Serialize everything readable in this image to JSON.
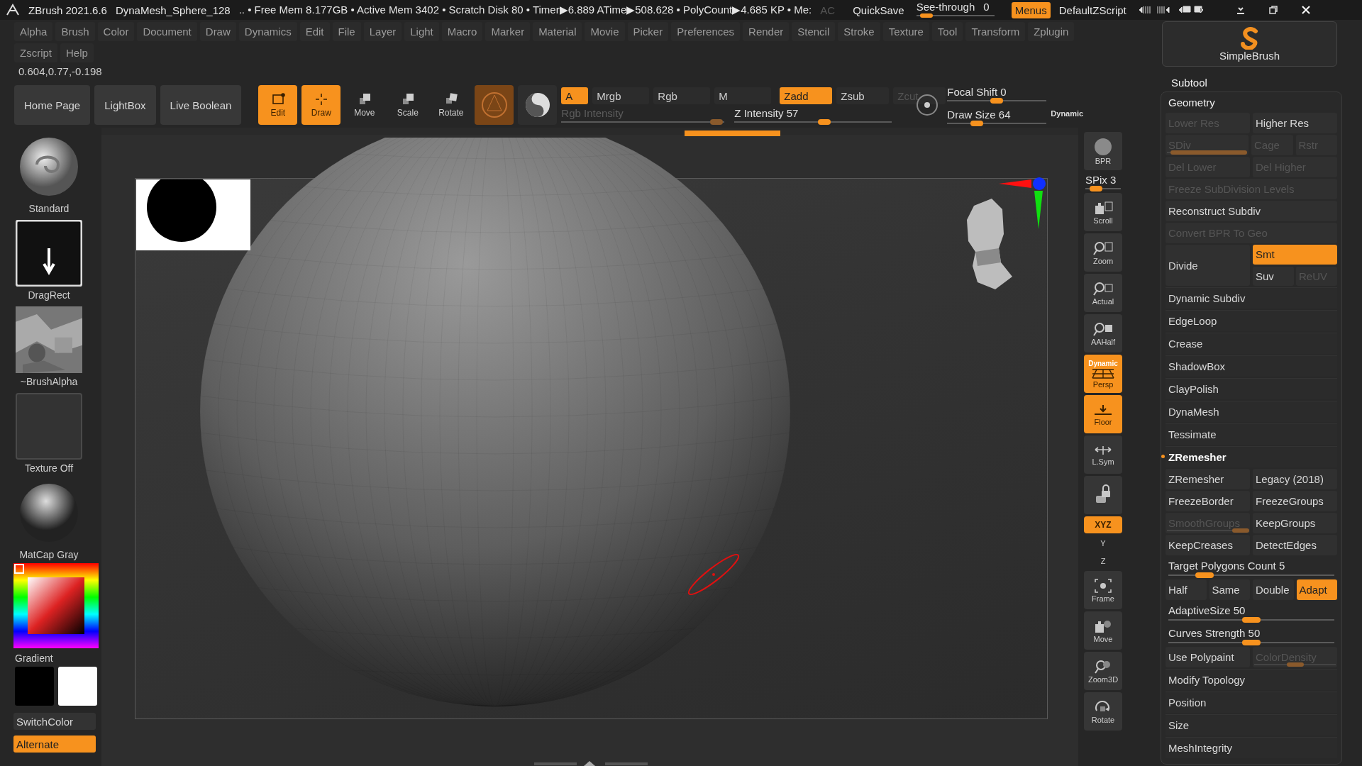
{
  "title_bar": {
    "app": "ZBrush 2021.6.6",
    "document": "DynaMesh_Sphere_128",
    "stats": ".. • Free Mem 8.177GB • Active Mem 3402 • Scratch Disk 80 •  Timer▶6.889 ATime▶508.628 • PolyCount▶4.685 KP  • Me:",
    "stats_dim": "AC",
    "quicksave": "QuickSave",
    "see_through": {
      "label": "See-through",
      "value": "0",
      "level": 0.05
    },
    "menus_button": {
      "label": "Menus",
      "selected": true
    },
    "script": "DefaultZScript"
  },
  "menu_rows": [
    [
      "Alpha",
      "Brush",
      "Color",
      "Document",
      "Draw",
      "Dynamics",
      "Edit",
      "File",
      "Layer",
      "Light",
      "Macro",
      "Marker",
      "Material",
      "Movie",
      "Picker",
      "Preferences",
      "Render",
      "Stencil",
      "Stroke",
      "Texture",
      "Tool",
      "Transform",
      "Zplugin"
    ],
    [
      "Zscript",
      "Help"
    ]
  ],
  "coordinates": "0.604,0.77,-0.198",
  "toolbar": {
    "nav_buttons": [
      "Home Page",
      "LightBox",
      "Live Boolean"
    ],
    "mode_buttons": [
      {
        "label": "Edit",
        "selected": true
      },
      {
        "label": "Draw",
        "selected": true
      },
      {
        "label": "Move",
        "selected": false
      },
      {
        "label": "Scale",
        "selected": false
      },
      {
        "label": "Rotate",
        "selected": false
      }
    ],
    "channels": [
      {
        "label": "A",
        "selected": true,
        "disabled": false
      },
      {
        "label": "Mrgb",
        "selected": false,
        "disabled": false
      },
      {
        "label": "Rgb",
        "selected": false,
        "disabled": false
      },
      {
        "label": "M",
        "selected": false,
        "disabled": false
      }
    ],
    "depth": [
      {
        "label": "Zadd",
        "selected": true,
        "disabled": false
      },
      {
        "label": "Zsub",
        "selected": false,
        "disabled": false
      },
      {
        "label": "Zcut",
        "selected": false,
        "disabled": true
      }
    ],
    "rgb_intensity": {
      "label": "Rgb Intensity",
      "level": 0.95,
      "disabled": true
    },
    "z_intensity": {
      "label": "Z Intensity 57",
      "level": 0.57,
      "disabled": false
    },
    "focal_shift": {
      "label": "Focal Shift 0",
      "level": 0.5,
      "disabled": false
    },
    "draw_size": {
      "label": "Draw Size 64",
      "level": 0.3,
      "disabled": false
    },
    "dynamic": "Dynamic"
  },
  "left_panel": {
    "items": [
      {
        "label": "Standard",
        "kind": "brush"
      },
      {
        "label": "DragRect",
        "kind": "stroke"
      },
      {
        "label": "~BrushAlpha",
        "kind": "alpha"
      },
      {
        "label": "Texture Off",
        "kind": "texture"
      },
      {
        "label": "MatCap Gray",
        "kind": "material"
      }
    ],
    "gradient": "Gradient",
    "switch_color": "SwitchColor",
    "alternate": {
      "label": "Alternate",
      "selected": true
    }
  },
  "shelf": [
    {
      "kind": "tile",
      "label": "BPR",
      "selected": false
    },
    {
      "kind": "slider",
      "label": "SPix 3",
      "level": 0.3,
      "disabled": false
    },
    {
      "kind": "tile",
      "label": "Scroll",
      "selected": false
    },
    {
      "kind": "tile",
      "label": "Zoom",
      "selected": false
    },
    {
      "kind": "tile",
      "label": "Actual",
      "selected": false
    },
    {
      "kind": "tile",
      "label": "AAHalf",
      "selected": false
    },
    {
      "kind": "tile",
      "label": "Persp",
      "badge": "Dynamic",
      "selected": true
    },
    {
      "kind": "tile",
      "label": "Floor",
      "selected": true
    },
    {
      "kind": "tile",
      "label": "L.Sym",
      "selected": false
    },
    {
      "kind": "tile",
      "selected": false
    },
    {
      "kind": "pill",
      "label": "XYZ",
      "selected": true
    },
    {
      "kind": "mini",
      "label": "Y"
    },
    {
      "kind": "mini",
      "label": "Z"
    },
    {
      "kind": "tile",
      "label": "Frame",
      "selected": false
    },
    {
      "kind": "tile",
      "label": "Move",
      "selected": false
    },
    {
      "kind": "tile",
      "label": "Zoom3D",
      "selected": false
    },
    {
      "kind": "tile",
      "label": "Rotate",
      "selected": false
    }
  ],
  "right_panel": {
    "brush": "SimpleBrush",
    "subtool": "Subtool",
    "geometry": {
      "title": "Geometry",
      "rows": [
        {
          "kind": "buttons",
          "cells": [
            {
              "label": "Lower Res",
              "disabled": true,
              "selected": false
            },
            {
              "label": "Higher Res",
              "disabled": false,
              "selected": false
            }
          ]
        },
        {
          "kind": "buttons",
          "cells": [
            {
              "label": "SDiv",
              "disabled": true,
              "selected": false,
              "level": 1
            },
            {
              "label": "Cage",
              "disabled": true,
              "selected": false
            },
            {
              "label": "Rstr",
              "disabled": true,
              "selected": false
            }
          ]
        },
        {
          "kind": "buttons",
          "cells": [
            {
              "label": "Del Lower",
              "disabled": true,
              "selected": false
            },
            {
              "label": "Del Higher",
              "disabled": true,
              "selected": false
            }
          ]
        },
        {
          "kind": "buttons",
          "cells": [
            {
              "label": "Freeze SubDivision Levels",
              "disabled": true,
              "selected": false
            }
          ]
        },
        {
          "kind": "buttons",
          "cells": [
            {
              "label": "Reconstruct Subdiv",
              "disabled": false,
              "selected": false
            }
          ]
        },
        {
          "kind": "buttons",
          "cells": [
            {
              "label": "Convert BPR To Geo",
              "disabled": true,
              "selected": false
            }
          ]
        },
        {
          "kind": "divide",
          "label": "Divide",
          "cells": [
            {
              "label": "Smt",
              "disabled": false,
              "selected": true
            },
            {
              "label": "Suv",
              "disabled": false,
              "selected": false
            },
            {
              "label": "ReUV",
              "disabled": true,
              "selected": false
            }
          ]
        },
        {
          "kind": "section",
          "label": "Dynamic Subdiv",
          "expanded": false
        },
        {
          "kind": "section",
          "label": "EdgeLoop",
          "expanded": false
        },
        {
          "kind": "section",
          "label": "Crease",
          "expanded": false
        },
        {
          "kind": "section",
          "label": "ShadowBox",
          "expanded": false
        },
        {
          "kind": "section",
          "label": "ClayPolish",
          "expanded": false
        },
        {
          "kind": "section",
          "label": "DynaMesh",
          "expanded": false
        },
        {
          "kind": "section",
          "label": "Tessimate",
          "expanded": false
        },
        {
          "kind": "section",
          "label": "ZRemesher",
          "expanded": true
        },
        {
          "kind": "buttons",
          "cells": [
            {
              "label": "ZRemesher",
              "disabled": false,
              "selected": false
            },
            {
              "label": "Legacy (2018)",
              "disabled": false,
              "selected": false
            }
          ]
        },
        {
          "kind": "buttons",
          "cells": [
            {
              "label": "FreezeBorder",
              "disabled": false,
              "selected": false
            },
            {
              "label": "FreezeGroups",
              "disabled": false,
              "selected": false
            }
          ]
        },
        {
          "kind": "buttons",
          "cells": [
            {
              "label": "SmoothGroups",
              "disabled": true,
              "selected": false,
              "level": 0.9
            },
            {
              "label": "KeepGroups",
              "disabled": false,
              "selected": false
            }
          ]
        },
        {
          "kind": "buttons",
          "cells": [
            {
              "label": "KeepCreases",
              "disabled": false,
              "selected": false
            },
            {
              "label": "DetectEdges",
              "disabled": false,
              "selected": false
            }
          ]
        },
        {
          "kind": "slider",
          "label": "Target Polygons Count 5",
          "level": 0.22
        },
        {
          "kind": "buttons",
          "cells": [
            {
              "label": "Half",
              "disabled": false,
              "selected": false
            },
            {
              "label": "Same",
              "disabled": false,
              "selected": false
            },
            {
              "label": "Double",
              "disabled": false,
              "selected": false
            },
            {
              "label": "Adapt",
              "disabled": false,
              "selected": true
            }
          ]
        },
        {
          "kind": "slider",
          "label": "AdaptiveSize 50",
          "level": 0.5
        },
        {
          "kind": "slider",
          "label": "Curves Strength 50",
          "level": 0.5
        },
        {
          "kind": "buttons",
          "cells": [
            {
              "label": "Use Polypaint",
              "disabled": false,
              "selected": false
            },
            {
              "label": "ColorDensity",
              "disabled": true,
              "selected": false,
              "level": 0.5
            }
          ]
        },
        {
          "kind": "section",
          "label": "Modify Topology",
          "expanded": false
        },
        {
          "kind": "section",
          "label": "Position",
          "expanded": false
        },
        {
          "kind": "section",
          "label": "Size",
          "expanded": false
        },
        {
          "kind": "section",
          "label": "MeshIntegrity",
          "expanded": false
        }
      ]
    }
  }
}
